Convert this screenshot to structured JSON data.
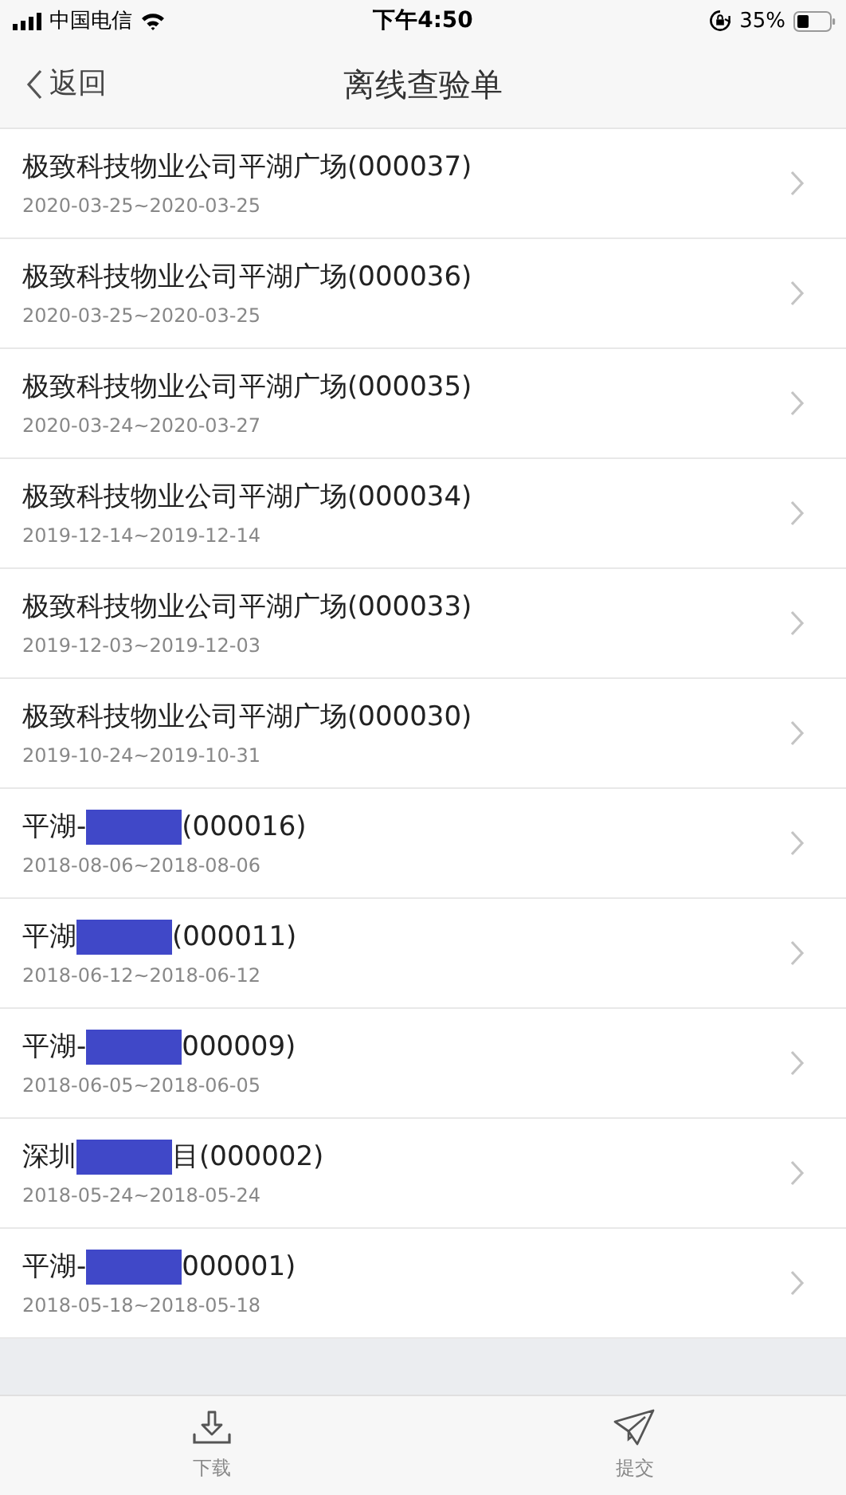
{
  "status_bar": {
    "carrier": "中国电信",
    "time": "下午4:50",
    "battery": "35%"
  },
  "nav": {
    "back": "返回",
    "title": "离线查验单"
  },
  "items": [
    {
      "kind": "plain",
      "title": "极致科技物业公司平湖广场(000037)",
      "dates": "2020-03-25~2020-03-25"
    },
    {
      "kind": "plain",
      "title": "极致科技物业公司平湖广场(000036)",
      "dates": "2020-03-25~2020-03-25"
    },
    {
      "kind": "plain",
      "title": "极致科技物业公司平湖广场(000035)",
      "dates": "2020-03-24~2020-03-27"
    },
    {
      "kind": "plain",
      "title": "极致科技物业公司平湖广场(000034)",
      "dates": "2019-12-14~2019-12-14"
    },
    {
      "kind": "plain",
      "title": "极致科技物业公司平湖广场(000033)",
      "dates": "2019-12-03~2019-12-03"
    },
    {
      "kind": "plain",
      "title": "极致科技物业公司平湖广场(000030)",
      "dates": "2019-10-24~2019-10-31"
    },
    {
      "kind": "redacted",
      "title_start": "平湖-",
      "title_end": "(000016)",
      "dates": "2018-08-06~2018-08-06"
    },
    {
      "kind": "redacted",
      "title_start": "平湖",
      "title_end": "(000011)",
      "dates": "2018-06-12~2018-06-12"
    },
    {
      "kind": "redacted",
      "title_start": "平湖-",
      "title_end": "000009)",
      "dates": "2018-06-05~2018-06-05"
    },
    {
      "kind": "redacted",
      "title_start": "深圳",
      "title_end": "目(000002)",
      "dates": "2018-05-24~2018-05-24"
    },
    {
      "kind": "redacted",
      "title_start": "平湖-",
      "title_end": "000001)",
      "dates": "2018-05-18~2018-05-18"
    }
  ],
  "toolbar": [
    {
      "kind": "download",
      "label": "下载"
    },
    {
      "kind": "submit",
      "label": "提交"
    }
  ]
}
